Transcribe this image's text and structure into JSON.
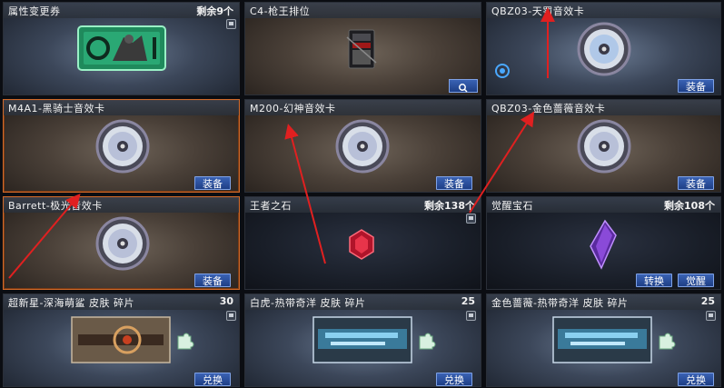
{
  "cards": [
    {
      "title": "属性变更券",
      "count": "剩余9个"
    },
    {
      "title": "C4-枪王排位",
      "count": ""
    },
    {
      "title": "QBZ03-天罚音效卡",
      "count": "",
      "button": "装备"
    },
    {
      "title": "M4A1-黑骑士音效卡",
      "button": "装备"
    },
    {
      "title": "M200-幻神音效卡",
      "button": "装备"
    },
    {
      "title": "QBZ03-金色蔷薇音效卡",
      "button": "装备"
    },
    {
      "title": "Barrett-极光音效卡",
      "button": "装备"
    },
    {
      "title": "王者之石",
      "count": "剩余138个"
    },
    {
      "title": "觉醒宝石",
      "count": "剩余108个",
      "button_convert": "转换",
      "button_awaken": "觉醒"
    },
    {
      "title": "超新星-深海萌鲨 皮肤 碎片",
      "count": "30",
      "button": "兑换"
    },
    {
      "title": "白虎-热带奇洋 皮肤 碎片",
      "count": "25",
      "button": "兑换"
    },
    {
      "title": "金色蔷薇-热带奇洋 皮肤 碎片",
      "count": "25",
      "button": "兑换"
    }
  ],
  "colors": {
    "accent": "#d06a2a",
    "button": "#2a4f9e",
    "arrow": "#e02020"
  }
}
